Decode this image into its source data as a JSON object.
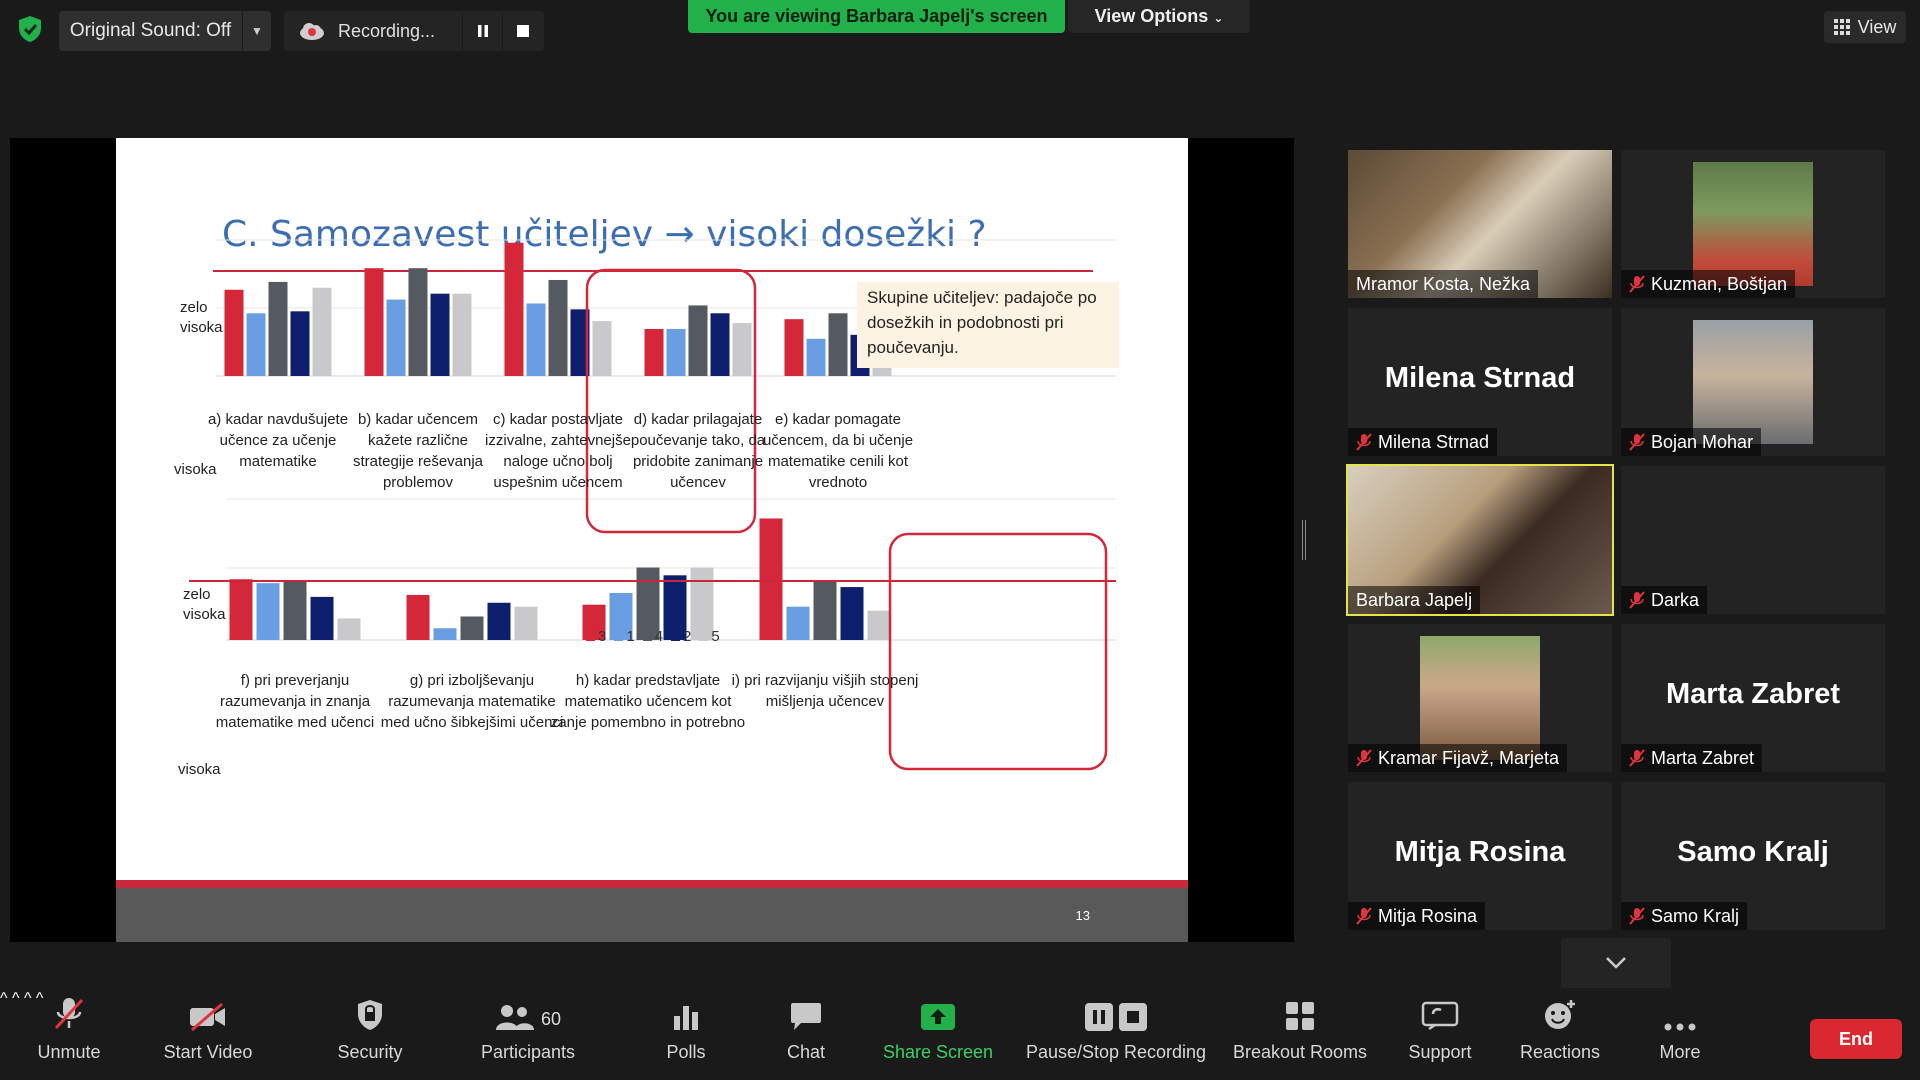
{
  "topbar": {
    "original_sound": "Original Sound: Off",
    "recording": "Recording...",
    "viewing_banner": "You are viewing Barbara Japelj's screen",
    "view_options": "View Options",
    "view": "View"
  },
  "slide": {
    "title": "C. Samozavest učiteljev → visoki dosežki ?",
    "ylabel_top_high": "zelo\nvisoka",
    "ylabel_top_low": "visoka",
    "ylabel_bottom_high": "zelo\nvisoka",
    "ylabel_bottom_low": "visoka",
    "callout": "Skupine učiteljev: padajoče po dosežkih in podobnosti pri poučevanju.",
    "page_number": "13"
  },
  "chart_data": {
    "type": "bar",
    "series_names": [
      "3",
      "1",
      "4",
      "2",
      "5"
    ],
    "series_colors": [
      "#d4273a",
      "#6a9ee3",
      "#555a60",
      "#0e1f6e",
      "#c9c9cc"
    ],
    "top_panel": {
      "categories": [
        "a) kadar navdušujete\nučence za učenje\nmatematike",
        "b) kadar učencem\nkažete različne\nstrategije reševanja\nproblemov",
        "c) kadar postavljate\nizzivalne, zahtevnejše\nnaloge učno bolj\nuspešnim učencem",
        "d) kadar prilagajate\npoučevanje tako, da\npridobite zanimanje\nučencev",
        "e) kadar pomagate\nučencem, da bi učenje\nmatematike cenili kot\nvrednoto"
      ],
      "values": [
        [
          0.44,
          0.32,
          0.48,
          0.33,
          0.45
        ],
        [
          0.55,
          0.39,
          0.55,
          0.42,
          0.42
        ],
        [
          0.68,
          0.37,
          0.49,
          0.34,
          0.28
        ],
        [
          0.24,
          0.24,
          0.36,
          0.32,
          0.27
        ],
        [
          0.29,
          0.19,
          0.32,
          0.21,
          0.25
        ]
      ]
    },
    "bottom_panel": {
      "categories": [
        "f) pri preverjanju\nrazumevanja in znanja\nmatematike med učenci",
        "g) pri izboljševanju\nrazumevanja matematike\nmed učno šibkejšimi učenci",
        "h) kadar predstavljate\nmatematiko učencem kot\nzanje pomembno in potrebno",
        "i) pri razvijanju višjih stopenj\nmišljenja učencev"
      ],
      "values": [
        [
          0.31,
          0.29,
          0.3,
          0.22,
          0.11
        ],
        [
          0.23,
          0.06,
          0.12,
          0.19,
          0.17
        ],
        [
          0.18,
          0.24,
          0.37,
          0.33,
          0.37
        ],
        [
          0.62,
          0.17,
          0.3,
          0.27,
          0.15
        ]
      ]
    },
    "highlighted": [
      "c",
      "i"
    ]
  },
  "participants": [
    {
      "name": "Mramor Kosta, Nežka",
      "video": true,
      "muted": false
    },
    {
      "name": "Kuzman, Boštjan",
      "video": true,
      "muted": true
    },
    {
      "name": "Milena Strnad",
      "video": false,
      "muted": true
    },
    {
      "name": "Bojan Mohar",
      "video": true,
      "muted": true
    },
    {
      "name": "Barbara Japelj",
      "video": true,
      "muted": false,
      "active_speaker": true
    },
    {
      "name": "Darka",
      "video": false,
      "muted": true
    },
    {
      "name": "Kramar Fijavž, Marjeta",
      "video": true,
      "muted": true
    },
    {
      "name": "Marta Zabret",
      "video": false,
      "muted": true
    },
    {
      "name": "Mitja Rosina",
      "video": false,
      "muted": true
    },
    {
      "name": "Samo Kralj",
      "video": false,
      "muted": true
    }
  ],
  "toolbar": {
    "unmute": "Unmute",
    "start_video": "Start Video",
    "security": "Security",
    "participants": "Participants",
    "participants_count": "60",
    "polls": "Polls",
    "chat": "Chat",
    "share_screen": "Share Screen",
    "pause_stop": "Pause/Stop Recording",
    "breakout": "Breakout Rooms",
    "support": "Support",
    "reactions": "Reactions",
    "more": "More",
    "end": "End"
  },
  "colors": {
    "share_green": "#22b04a",
    "end_red": "#d9282f",
    "active_border": "#e6e24a",
    "slide_title_blue": "#3d6eb4"
  }
}
